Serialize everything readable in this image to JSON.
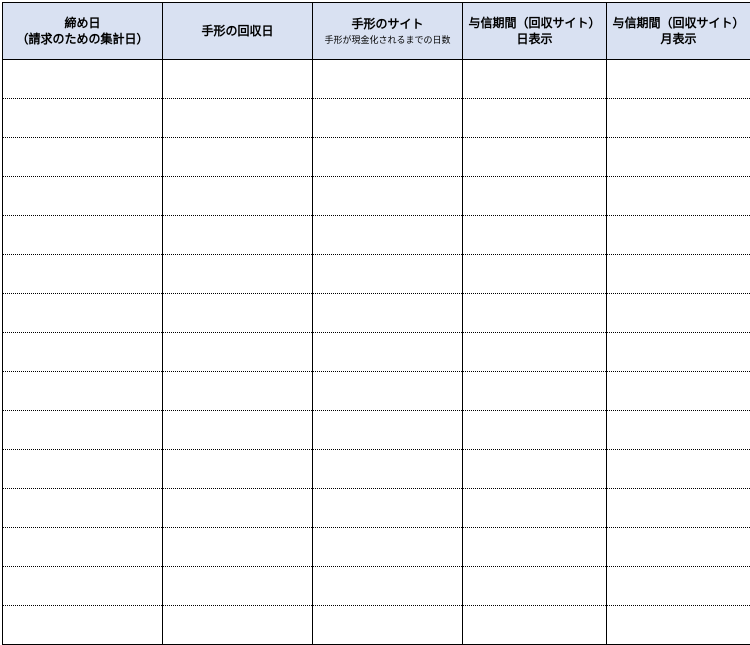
{
  "headers": {
    "col1_line1": "締め日",
    "col1_line2": "（請求のための集計日）",
    "col2": "手形の回収日",
    "col3_main": "手形のサイト",
    "col3_sub": "手形が現金化されるまでの日数",
    "col4_line1": "与信期間（回収サイト）",
    "col4_line2": "日表示",
    "col5_line1": "与信期間（回収サイト）",
    "col5_line2": "月表示"
  },
  "rows": [
    {
      "c1": "",
      "c2": "",
      "c3": "",
      "c4": "",
      "c5": ""
    },
    {
      "c1": "",
      "c2": "",
      "c3": "",
      "c4": "",
      "c5": ""
    },
    {
      "c1": "",
      "c2": "",
      "c3": "",
      "c4": "",
      "c5": ""
    },
    {
      "c1": "",
      "c2": "",
      "c3": "",
      "c4": "",
      "c5": ""
    },
    {
      "c1": "",
      "c2": "",
      "c3": "",
      "c4": "",
      "c5": ""
    },
    {
      "c1": "",
      "c2": "",
      "c3": "",
      "c4": "",
      "c5": ""
    },
    {
      "c1": "",
      "c2": "",
      "c3": "",
      "c4": "",
      "c5": ""
    },
    {
      "c1": "",
      "c2": "",
      "c3": "",
      "c4": "",
      "c5": ""
    },
    {
      "c1": "",
      "c2": "",
      "c3": "",
      "c4": "",
      "c5": ""
    },
    {
      "c1": "",
      "c2": "",
      "c3": "",
      "c4": "",
      "c5": ""
    },
    {
      "c1": "",
      "c2": "",
      "c3": "",
      "c4": "",
      "c5": ""
    },
    {
      "c1": "",
      "c2": "",
      "c3": "",
      "c4": "",
      "c5": ""
    },
    {
      "c1": "",
      "c2": "",
      "c3": "",
      "c4": "",
      "c5": ""
    },
    {
      "c1": "",
      "c2": "",
      "c3": "",
      "c4": "",
      "c5": ""
    },
    {
      "c1": "",
      "c2": "",
      "c3": "",
      "c4": "",
      "c5": ""
    }
  ]
}
